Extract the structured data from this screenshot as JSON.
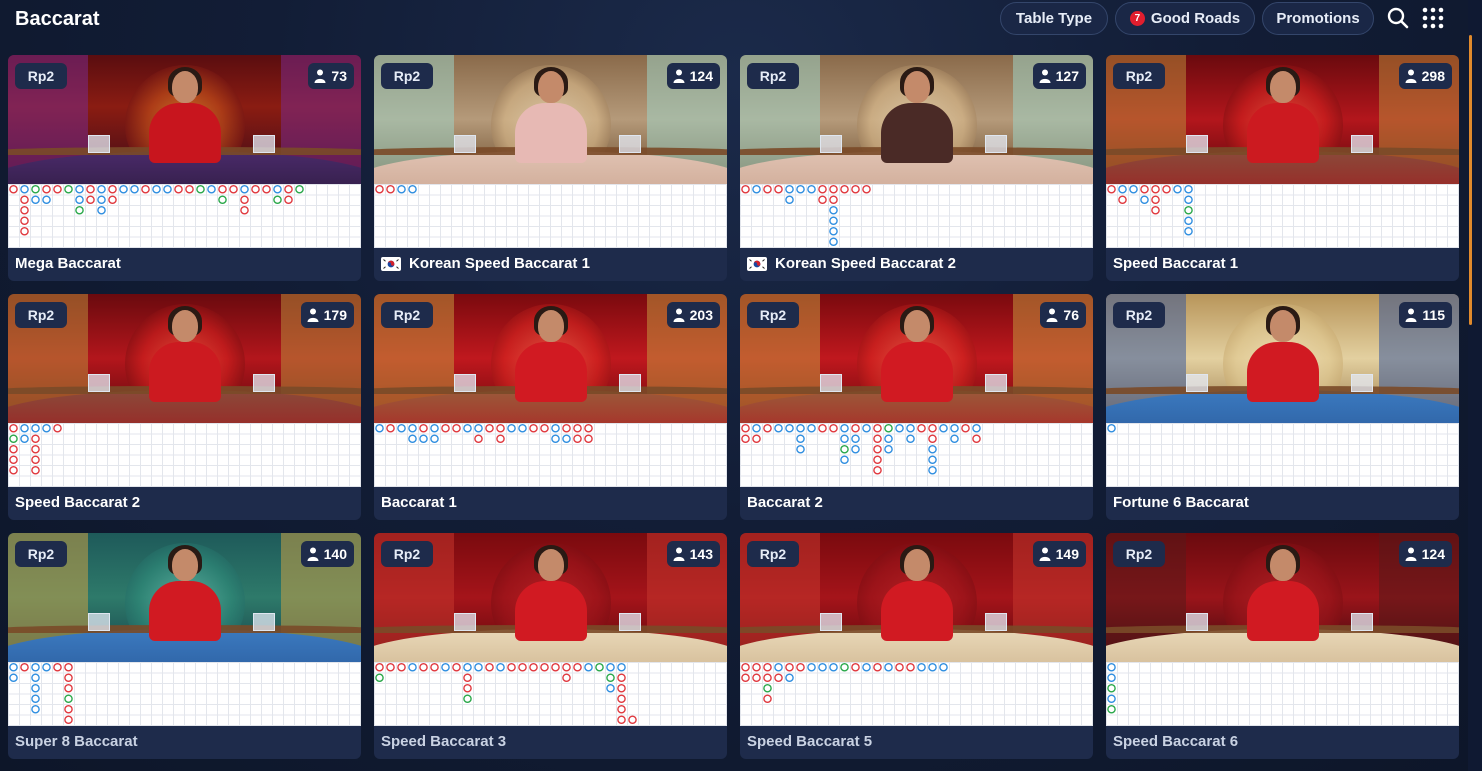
{
  "header": {
    "title": "Baccarat",
    "filters": {
      "table_type": "Table Type",
      "good_roads": "Good Roads",
      "good_roads_count": "7",
      "promotions": "Promotions"
    },
    "icons": [
      "search-icon",
      "grid-menu-icon"
    ]
  },
  "colors": {
    "background": "#121d36",
    "card": "#1e2b4b",
    "badge_red": "#e01e2e",
    "road_banker": "#e0383e",
    "road_player": "#2f8ee0",
    "road_tie": "#2aa84a",
    "scroll_accent": "#e08a2c"
  },
  "tables": [
    {
      "name": "Mega Baccarat",
      "limit": "Rp2",
      "players": "73",
      "flag": "",
      "theme": "mega",
      "road": [
        [
          0,
          0,
          "B"
        ],
        [
          1,
          0,
          "P"
        ],
        [
          2,
          0,
          "T"
        ],
        [
          3,
          0,
          "B"
        ],
        [
          4,
          0,
          "B"
        ],
        [
          5,
          0,
          "T"
        ],
        [
          6,
          0,
          "P"
        ],
        [
          7,
          0,
          "B"
        ],
        [
          8,
          0,
          "P"
        ],
        [
          9,
          0,
          "B"
        ],
        [
          10,
          0,
          "P"
        ],
        [
          11,
          0,
          "P"
        ],
        [
          12,
          0,
          "B"
        ],
        [
          13,
          0,
          "P"
        ],
        [
          14,
          0,
          "P"
        ],
        [
          15,
          0,
          "B"
        ],
        [
          16,
          0,
          "B"
        ],
        [
          17,
          0,
          "T"
        ],
        [
          18,
          0,
          "P"
        ],
        [
          19,
          0,
          "B"
        ],
        [
          20,
          0,
          "B"
        ],
        [
          21,
          0,
          "P"
        ],
        [
          22,
          0,
          "B"
        ],
        [
          23,
          0,
          "B"
        ],
        [
          24,
          0,
          "P"
        ],
        [
          25,
          0,
          "B"
        ],
        [
          26,
          0,
          "T"
        ],
        [
          1,
          1,
          "B"
        ],
        [
          2,
          1,
          "P"
        ],
        [
          3,
          1,
          "P"
        ],
        [
          6,
          1,
          "P"
        ],
        [
          7,
          1,
          "B"
        ],
        [
          8,
          1,
          "P"
        ],
        [
          9,
          1,
          "B"
        ],
        [
          19,
          1,
          "T"
        ],
        [
          21,
          1,
          "B"
        ],
        [
          24,
          1,
          "T"
        ],
        [
          25,
          1,
          "B"
        ],
        [
          1,
          2,
          "B"
        ],
        [
          6,
          2,
          "T"
        ],
        [
          8,
          2,
          "P"
        ],
        [
          21,
          2,
          "B"
        ],
        [
          1,
          3,
          "B"
        ],
        [
          1,
          4,
          "B"
        ]
      ]
    },
    {
      "name": "Korean Speed Baccarat 1",
      "limit": "Rp2",
      "players": "124",
      "flag": "kr",
      "theme": "korean",
      "road": [
        [
          0,
          0,
          "B"
        ],
        [
          1,
          0,
          "B"
        ],
        [
          2,
          0,
          "P"
        ],
        [
          3,
          0,
          "P"
        ]
      ]
    },
    {
      "name": "Korean Speed Baccarat 2",
      "limit": "Rp2",
      "players": "127",
      "flag": "kr",
      "theme": "korean2",
      "road": [
        [
          0,
          0,
          "B"
        ],
        [
          1,
          0,
          "P"
        ],
        [
          2,
          0,
          "B"
        ],
        [
          3,
          0,
          "B"
        ],
        [
          4,
          0,
          "P"
        ],
        [
          5,
          0,
          "P"
        ],
        [
          6,
          0,
          "P"
        ],
        [
          7,
          0,
          "B"
        ],
        [
          8,
          0,
          "B"
        ],
        [
          9,
          0,
          "B"
        ],
        [
          10,
          0,
          "B"
        ],
        [
          11,
          0,
          "B"
        ],
        [
          4,
          1,
          "P"
        ],
        [
          7,
          1,
          "B"
        ],
        [
          8,
          1,
          "B"
        ],
        [
          8,
          2,
          "P"
        ],
        [
          8,
          3,
          "P"
        ],
        [
          8,
          4,
          "P"
        ],
        [
          8,
          5,
          "P"
        ]
      ]
    },
    {
      "name": "Speed Baccarat 1",
      "limit": "Rp2",
      "players": "298",
      "flag": "",
      "theme": "red",
      "road": [
        [
          0,
          0,
          "B"
        ],
        [
          1,
          0,
          "P"
        ],
        [
          2,
          0,
          "P"
        ],
        [
          3,
          0,
          "B"
        ],
        [
          4,
          0,
          "B"
        ],
        [
          5,
          0,
          "B"
        ],
        [
          6,
          0,
          "P"
        ],
        [
          7,
          0,
          "P"
        ],
        [
          1,
          1,
          "B"
        ],
        [
          3,
          1,
          "P"
        ],
        [
          4,
          1,
          "B"
        ],
        [
          7,
          1,
          "P"
        ],
        [
          4,
          2,
          "B"
        ],
        [
          7,
          2,
          "T"
        ],
        [
          7,
          3,
          "P"
        ],
        [
          7,
          4,
          "P"
        ]
      ]
    },
    {
      "name": "Speed Baccarat 2",
      "limit": "Rp2",
      "players": "179",
      "flag": "",
      "theme": "red",
      "road": [
        [
          0,
          0,
          "B"
        ],
        [
          1,
          0,
          "P"
        ],
        [
          2,
          0,
          "P"
        ],
        [
          3,
          0,
          "P"
        ],
        [
          4,
          0,
          "B"
        ],
        [
          0,
          1,
          "T"
        ],
        [
          1,
          1,
          "P"
        ],
        [
          2,
          1,
          "B"
        ],
        [
          0,
          2,
          "B"
        ],
        [
          2,
          2,
          "B"
        ],
        [
          0,
          3,
          "B"
        ],
        [
          2,
          3,
          "B"
        ],
        [
          0,
          4,
          "B"
        ],
        [
          2,
          4,
          "B"
        ]
      ]
    },
    {
      "name": "Baccarat 1",
      "limit": "Rp2",
      "players": "203",
      "flag": "",
      "theme": "red2",
      "road": [
        [
          0,
          0,
          "P"
        ],
        [
          1,
          0,
          "B"
        ],
        [
          2,
          0,
          "P"
        ],
        [
          3,
          0,
          "P"
        ],
        [
          4,
          0,
          "B"
        ],
        [
          5,
          0,
          "P"
        ],
        [
          6,
          0,
          "B"
        ],
        [
          7,
          0,
          "B"
        ],
        [
          8,
          0,
          "P"
        ],
        [
          9,
          0,
          "P"
        ],
        [
          10,
          0,
          "B"
        ],
        [
          11,
          0,
          "B"
        ],
        [
          12,
          0,
          "P"
        ],
        [
          13,
          0,
          "P"
        ],
        [
          14,
          0,
          "B"
        ],
        [
          15,
          0,
          "B"
        ],
        [
          16,
          0,
          "P"
        ],
        [
          17,
          0,
          "B"
        ],
        [
          18,
          0,
          "B"
        ],
        [
          19,
          0,
          "B"
        ],
        [
          3,
          1,
          "P"
        ],
        [
          4,
          1,
          "P"
        ],
        [
          5,
          1,
          "P"
        ],
        [
          9,
          1,
          "B"
        ],
        [
          11,
          1,
          "B"
        ],
        [
          16,
          1,
          "P"
        ],
        [
          17,
          1,
          "P"
        ],
        [
          18,
          1,
          "B"
        ],
        [
          19,
          1,
          "B"
        ]
      ]
    },
    {
      "name": "Baccarat 2",
      "limit": "Rp2",
      "players": "76",
      "flag": "",
      "theme": "red2",
      "road": [
        [
          0,
          0,
          "B"
        ],
        [
          1,
          0,
          "P"
        ],
        [
          2,
          0,
          "B"
        ],
        [
          3,
          0,
          "P"
        ],
        [
          4,
          0,
          "P"
        ],
        [
          5,
          0,
          "P"
        ],
        [
          6,
          0,
          "P"
        ],
        [
          7,
          0,
          "B"
        ],
        [
          8,
          0,
          "B"
        ],
        [
          9,
          0,
          "P"
        ],
        [
          10,
          0,
          "B"
        ],
        [
          11,
          0,
          "P"
        ],
        [
          12,
          0,
          "B"
        ],
        [
          13,
          0,
          "T"
        ],
        [
          14,
          0,
          "P"
        ],
        [
          15,
          0,
          "P"
        ],
        [
          16,
          0,
          "B"
        ],
        [
          17,
          0,
          "B"
        ],
        [
          18,
          0,
          "P"
        ],
        [
          19,
          0,
          "P"
        ],
        [
          20,
          0,
          "B"
        ],
        [
          21,
          0,
          "P"
        ],
        [
          0,
          1,
          "B"
        ],
        [
          1,
          1,
          "B"
        ],
        [
          5,
          1,
          "P"
        ],
        [
          9,
          1,
          "P"
        ],
        [
          10,
          1,
          "P"
        ],
        [
          12,
          1,
          "B"
        ],
        [
          13,
          1,
          "P"
        ],
        [
          15,
          1,
          "P"
        ],
        [
          17,
          1,
          "B"
        ],
        [
          19,
          1,
          "P"
        ],
        [
          21,
          1,
          "B"
        ],
        [
          5,
          2,
          "P"
        ],
        [
          9,
          2,
          "T"
        ],
        [
          10,
          2,
          "P"
        ],
        [
          12,
          2,
          "B"
        ],
        [
          13,
          2,
          "P"
        ],
        [
          17,
          2,
          "P"
        ],
        [
          9,
          3,
          "P"
        ],
        [
          12,
          3,
          "B"
        ],
        [
          17,
          3,
          "P"
        ],
        [
          12,
          4,
          "B"
        ],
        [
          17,
          4,
          "P"
        ]
      ]
    },
    {
      "name": "Fortune 6 Baccarat",
      "limit": "Rp2",
      "players": "115",
      "flag": "",
      "theme": "fortune",
      "road": [
        [
          0,
          0,
          "P"
        ]
      ]
    },
    {
      "name": "Super 8 Baccarat",
      "limit": "Rp2",
      "players": "140",
      "flag": "",
      "theme": "super8",
      "road": [
        [
          0,
          0,
          "P"
        ],
        [
          1,
          0,
          "B"
        ],
        [
          2,
          0,
          "P"
        ],
        [
          3,
          0,
          "P"
        ],
        [
          4,
          0,
          "B"
        ],
        [
          5,
          0,
          "B"
        ],
        [
          0,
          1,
          "P"
        ],
        [
          2,
          1,
          "P"
        ],
        [
          5,
          1,
          "B"
        ],
        [
          2,
          2,
          "P"
        ],
        [
          5,
          2,
          "B"
        ],
        [
          2,
          3,
          "P"
        ],
        [
          5,
          3,
          "T"
        ],
        [
          2,
          4,
          "P"
        ],
        [
          5,
          4,
          "B"
        ],
        [
          5,
          5,
          "B"
        ]
      ]
    },
    {
      "name": "Speed Baccarat 3",
      "limit": "Rp2",
      "players": "143",
      "flag": "",
      "theme": "cn",
      "road": [
        [
          0,
          0,
          "B"
        ],
        [
          1,
          0,
          "B"
        ],
        [
          2,
          0,
          "B"
        ],
        [
          3,
          0,
          "P"
        ],
        [
          4,
          0,
          "B"
        ],
        [
          5,
          0,
          "B"
        ],
        [
          6,
          0,
          "P"
        ],
        [
          7,
          0,
          "B"
        ],
        [
          8,
          0,
          "P"
        ],
        [
          9,
          0,
          "P"
        ],
        [
          10,
          0,
          "B"
        ],
        [
          11,
          0,
          "P"
        ],
        [
          12,
          0,
          "B"
        ],
        [
          13,
          0,
          "B"
        ],
        [
          14,
          0,
          "B"
        ],
        [
          15,
          0,
          "B"
        ],
        [
          16,
          0,
          "B"
        ],
        [
          17,
          0,
          "B"
        ],
        [
          18,
          0,
          "B"
        ],
        [
          19,
          0,
          "P"
        ],
        [
          20,
          0,
          "T"
        ],
        [
          21,
          0,
          "P"
        ],
        [
          22,
          0,
          "P"
        ],
        [
          0,
          1,
          "T"
        ],
        [
          8,
          1,
          "B"
        ],
        [
          17,
          1,
          "B"
        ],
        [
          21,
          1,
          "T"
        ],
        [
          22,
          1,
          "B"
        ],
        [
          8,
          2,
          "B"
        ],
        [
          21,
          2,
          "P"
        ],
        [
          22,
          2,
          "B"
        ],
        [
          8,
          3,
          "T"
        ],
        [
          22,
          3,
          "B"
        ],
        [
          22,
          4,
          "B"
        ],
        [
          22,
          5,
          "B"
        ],
        [
          23,
          5,
          "B"
        ]
      ]
    },
    {
      "name": "Speed Baccarat 5",
      "limit": "Rp2",
      "players": "149",
      "flag": "",
      "theme": "cn",
      "road": [
        [
          0,
          0,
          "B"
        ],
        [
          1,
          0,
          "B"
        ],
        [
          2,
          0,
          "B"
        ],
        [
          3,
          0,
          "P"
        ],
        [
          4,
          0,
          "B"
        ],
        [
          5,
          0,
          "B"
        ],
        [
          6,
          0,
          "P"
        ],
        [
          7,
          0,
          "P"
        ],
        [
          8,
          0,
          "P"
        ],
        [
          9,
          0,
          "T"
        ],
        [
          10,
          0,
          "B"
        ],
        [
          11,
          0,
          "P"
        ],
        [
          12,
          0,
          "B"
        ],
        [
          13,
          0,
          "P"
        ],
        [
          14,
          0,
          "B"
        ],
        [
          15,
          0,
          "B"
        ],
        [
          16,
          0,
          "P"
        ],
        [
          17,
          0,
          "P"
        ],
        [
          18,
          0,
          "P"
        ],
        [
          0,
          1,
          "B"
        ],
        [
          1,
          1,
          "B"
        ],
        [
          2,
          1,
          "B"
        ],
        [
          3,
          1,
          "B"
        ],
        [
          4,
          1,
          "P"
        ],
        [
          2,
          2,
          "T"
        ],
        [
          2,
          3,
          "B"
        ]
      ]
    },
    {
      "name": "Speed Baccarat 6",
      "limit": "Rp2",
      "players": "124",
      "flag": "",
      "theme": "cn2",
      "road": [
        [
          0,
          0,
          "P"
        ],
        [
          0,
          1,
          "P"
        ],
        [
          0,
          2,
          "T"
        ],
        [
          0,
          3,
          "P"
        ],
        [
          0,
          4,
          "T"
        ]
      ]
    }
  ]
}
